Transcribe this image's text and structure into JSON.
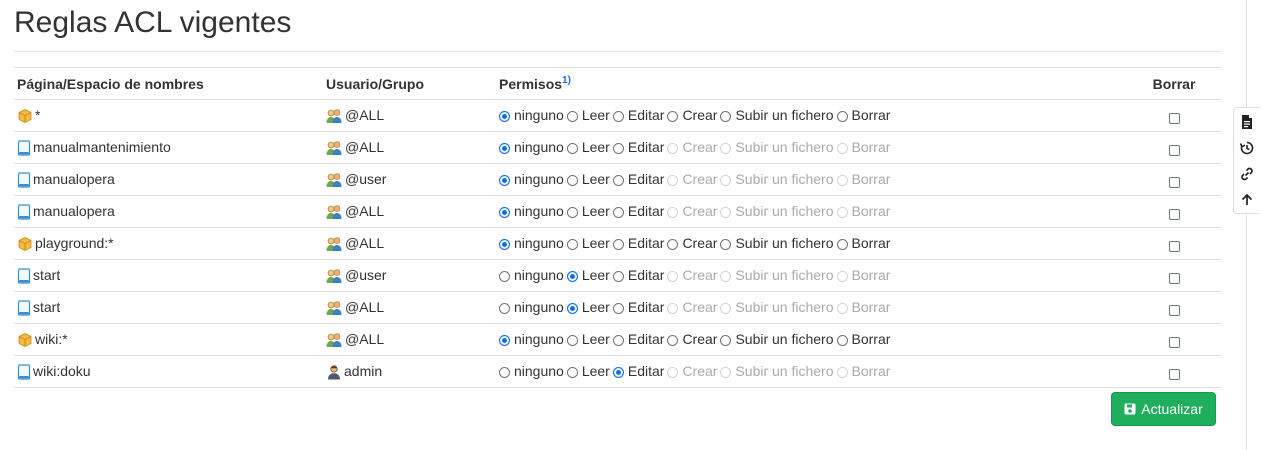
{
  "page_title": "Reglas ACL vigentes",
  "table": {
    "headers": {
      "page": "Página/Espacio de nombres",
      "user": "Usuario/Grupo",
      "perms": "Permisos",
      "perms_footnote": "1)",
      "delete": "Borrar"
    },
    "perm_labels": [
      "ninguno",
      "Leer",
      "Editar",
      "Crear",
      "Subir un fichero",
      "Borrar"
    ],
    "rows": [
      {
        "page": "*",
        "page_icon": "namespace-icon",
        "user": "@ALL",
        "user_icon": "group-icon",
        "selected": 0,
        "namespace": true
      },
      {
        "page": "manualmantenimiento",
        "page_icon": "page-icon",
        "user": "@ALL",
        "user_icon": "group-icon",
        "selected": 0,
        "namespace": false
      },
      {
        "page": "manualopera",
        "page_icon": "page-icon",
        "user": "@user",
        "user_icon": "group-icon",
        "selected": 0,
        "namespace": false
      },
      {
        "page": "manualopera",
        "page_icon": "page-icon",
        "user": "@ALL",
        "user_icon": "group-icon",
        "selected": 0,
        "namespace": false
      },
      {
        "page": "playground:*",
        "page_icon": "namespace-icon",
        "user": "@ALL",
        "user_icon": "group-icon",
        "selected": 0,
        "namespace": true
      },
      {
        "page": "start",
        "page_icon": "page-icon",
        "user": "@user",
        "user_icon": "group-icon",
        "selected": 1,
        "namespace": false
      },
      {
        "page": "start",
        "page_icon": "page-icon",
        "user": "@ALL",
        "user_icon": "group-icon",
        "selected": 1,
        "namespace": false
      },
      {
        "page": "wiki:*",
        "page_icon": "namespace-icon",
        "user": "@ALL",
        "user_icon": "group-icon",
        "selected": 0,
        "namespace": true
      },
      {
        "page": "wiki:doku",
        "page_icon": "page-icon",
        "user": "admin",
        "user_icon": "user-icon",
        "selected": 2,
        "namespace": false
      }
    ]
  },
  "update_button": "Actualizar",
  "side_tools": [
    "document-icon",
    "history-icon",
    "link-icon",
    "arrow-up-icon"
  ],
  "colors": {
    "accent": "#0d6efd",
    "button": "#1fae5b"
  }
}
